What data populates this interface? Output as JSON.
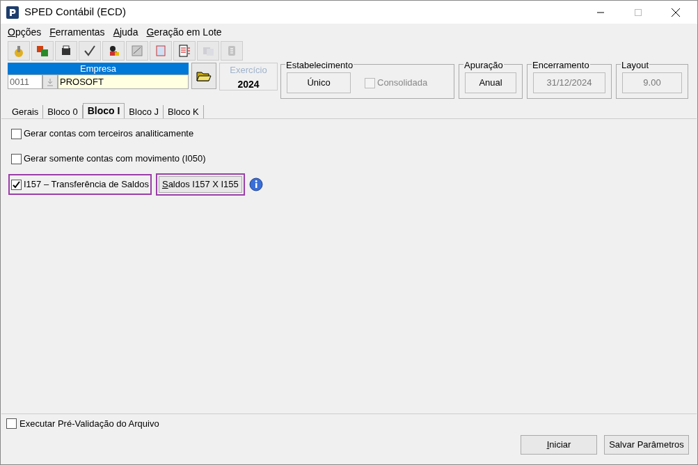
{
  "window": {
    "title": "SPED Contábil (ECD)"
  },
  "menu": [
    "Opções",
    "Ferramentas",
    "Ajuda",
    "Geração em Lote"
  ],
  "toolbar": [
    {
      "disabled": false
    },
    {
      "disabled": false
    },
    {
      "disabled": false
    },
    {
      "disabled": false
    },
    {
      "disabled": false
    },
    {
      "disabled": false
    },
    {
      "disabled": false
    },
    {
      "disabled": false
    },
    {
      "disabled": true
    },
    {
      "disabled": true
    }
  ],
  "empresa": {
    "label": "Empresa",
    "code": "0011",
    "name": "PROSOFT"
  },
  "exercicio": {
    "label": "Exercício",
    "value": "2024"
  },
  "estabelecimento": {
    "label": "Estabelecimento",
    "value": "Único",
    "consolidada": {
      "label": "Consolidada",
      "checked": false,
      "disabled": true
    }
  },
  "apuracao": {
    "label": "Apuração",
    "value": "Anual"
  },
  "encerramento": {
    "label": "Encerramento",
    "value": "31/12/2024"
  },
  "layout": {
    "label": "Layout",
    "value": "9.00"
  },
  "tabs": [
    {
      "label": "Gerais",
      "selected": false
    },
    {
      "label": "Bloco 0",
      "selected": false
    },
    {
      "label": "Bloco I",
      "selected": true
    },
    {
      "label": "Bloco J",
      "selected": false
    },
    {
      "label": "Bloco K",
      "selected": false
    }
  ],
  "options": [
    {
      "label": "Gerar contas com terceiros analiticamente",
      "checked": false,
      "highlighted": false
    },
    {
      "label": "Gerar somente contas com movimento (I050)",
      "checked": false,
      "highlighted": false
    },
    {
      "label": "I157 – Transferência de Saldos",
      "checked": true,
      "highlighted": true,
      "button": {
        "label": "Saldos I157 X I155",
        "highlighted": true
      }
    }
  ],
  "prevalidacao": {
    "label": "Executar Pré-Validação do Arquivo",
    "checked": false
  },
  "buttons": [
    "Iniciar",
    "Salvar Parâmetros"
  ]
}
